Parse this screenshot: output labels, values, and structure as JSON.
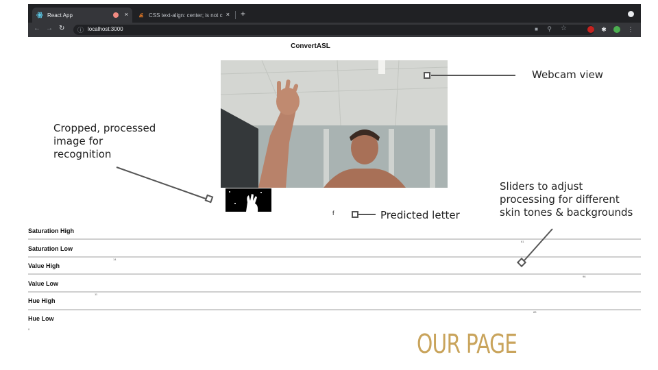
{
  "browser": {
    "tabs": [
      {
        "title": "React App",
        "active": true
      },
      {
        "title": "CSS text-align: center; is not c",
        "active": false
      }
    ],
    "new_tab_icon": "+",
    "url": "localhost:3000",
    "close_icon": "×"
  },
  "page": {
    "title": "ConvertASL",
    "predicted_letter": "f",
    "sliders": [
      {
        "label": "Saturation High",
        "value": "61"
      },
      {
        "label": "Saturation Low",
        "value": "14"
      },
      {
        "label": "Value High",
        "value": "96"
      },
      {
        "label": "Value Low",
        "value": "11"
      },
      {
        "label": "Hue High",
        "value": "83"
      },
      {
        "label": "Hue Low",
        "value": "0"
      }
    ]
  },
  "annotations": {
    "webcam": "Webcam view",
    "cropped": [
      "Cropped, processed",
      "image for",
      "recognition"
    ],
    "predicted": "Predicted letter",
    "sliders": [
      "Sliders to adjust",
      "processing for different",
      "skin tones & backgrounds"
    ]
  },
  "footer": {
    "title": "OUR PAGE"
  },
  "colors": {
    "accent": "#c9a45c",
    "chrome_dark": "#202124",
    "chrome_bar": "#35363a"
  }
}
